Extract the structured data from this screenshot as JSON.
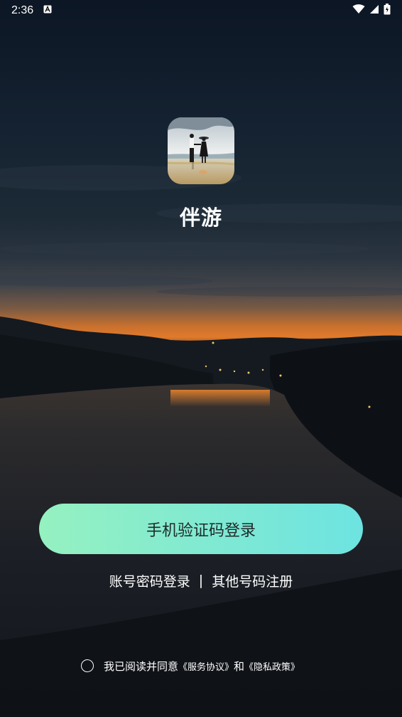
{
  "status_bar": {
    "time": "2:36",
    "notification_icon": "a-square-icon",
    "icons": [
      "wifi-icon",
      "signal-icon",
      "battery-charging-icon"
    ]
  },
  "app": {
    "icon": "couple-on-beach-image",
    "name": "伴游"
  },
  "actions": {
    "sms_login": "手机验证码登录",
    "password_login": "账号密码登录",
    "separator": "|",
    "register": "其他号码注册"
  },
  "agreement": {
    "prefix": "我已阅读并同意",
    "service": "《服务协议》",
    "and": "和",
    "privacy": "《隐私政策》",
    "checked": false
  },
  "colors": {
    "button_gradient_start": "#95f1c0",
    "button_gradient_end": "#6de3e1",
    "sky_top": "#0d1726",
    "sunset_glow": "#e07a2a"
  }
}
